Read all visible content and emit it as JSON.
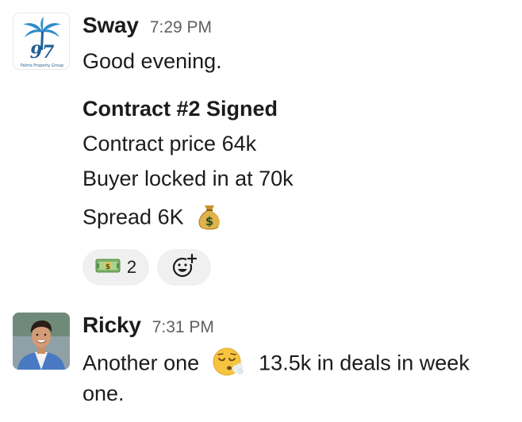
{
  "messages": [
    {
      "sender": "Sway",
      "time": "7:29 PM",
      "avatar": {
        "text": "97",
        "caption": "Palms Property Group",
        "icon": "palm-tree-logo"
      },
      "lines": [
        {
          "text": "Good evening."
        },
        {
          "text": "Contract #2 Signed"
        },
        {
          "text": "Contract price 64k"
        },
        {
          "text": "Buyer locked in at 70k"
        },
        {
          "text": "Spread 6K",
          "emoji": "money-bag-emoji"
        }
      ],
      "reactions": [
        {
          "emoji": "dollar-banknote-emoji",
          "count": "2"
        },
        {
          "emoji": "add-reaction-icon",
          "count": ""
        }
      ]
    },
    {
      "sender": "Ricky",
      "time": "7:31 PM",
      "avatar": {
        "icon": "user-photo"
      },
      "lines": [
        {
          "text_before": "Another one",
          "emoji": "face-exhaling-emoji",
          "text_after": "13.5k in deals in week"
        },
        {
          "text": "one."
        }
      ]
    }
  ],
  "colors": {
    "text": "#1d1c1d",
    "timestamp": "#616061",
    "reaction_bg": "#f0f0f0",
    "logo_blue": "#2e8bc9"
  }
}
